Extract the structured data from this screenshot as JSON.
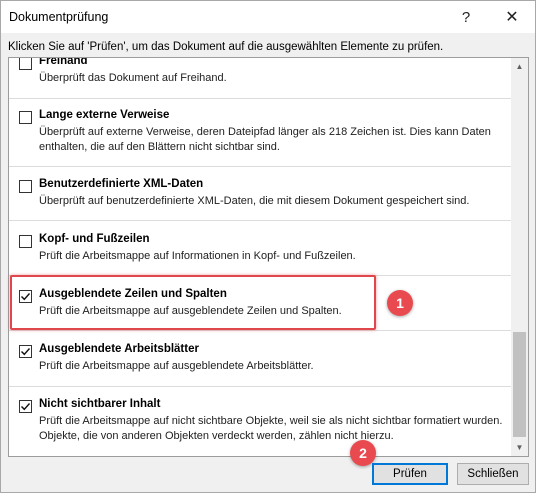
{
  "window": {
    "title": "Dokumentprüfung",
    "help_label": "?",
    "close_label": "✕"
  },
  "instruction": "Klicken Sie auf 'Prüfen', um das Dokument auf die ausgewählten Elemente zu prüfen.",
  "items": [
    {
      "title": "Freihand",
      "desc": "Überprüft das Dokument auf Freihand.",
      "checked": false
    },
    {
      "title": "Lange externe Verweise",
      "desc": "Überprüft auf externe Verweise, deren Dateipfad länger als 218 Zeichen ist. Dies kann Daten enthalten, die auf den Blättern nicht sichtbar sind.",
      "checked": false
    },
    {
      "title": "Benutzerdefinierte XML-Daten",
      "desc": "Überprüft auf benutzerdefinierte XML-Daten, die mit diesem Dokument gespeichert sind.",
      "checked": false
    },
    {
      "title": "Kopf- und Fußzeilen",
      "desc": "Prüft die Arbeitsmappe auf Informationen in Kopf- und Fußzeilen.",
      "checked": false
    },
    {
      "title": "Ausgeblendete Zeilen und Spalten",
      "desc": "Prüft die Arbeitsmappe auf ausgeblendete Zeilen und Spalten.",
      "checked": true
    },
    {
      "title": "Ausgeblendete Arbeitsblätter",
      "desc": "Prüft die Arbeitsmappe auf ausgeblendete Arbeitsblätter.",
      "checked": true
    },
    {
      "title": "Nicht sichtbarer Inhalt",
      "desc": "Prüft die Arbeitsmappe auf nicht sichtbare Objekte, weil sie als nicht sichtbar formatiert wurden. Objekte, die von anderen Objekten verdeckt werden, zählen nicht hierzu.",
      "checked": true
    }
  ],
  "annotations": {
    "badge_1": "1",
    "badge_2": "2"
  },
  "buttons": {
    "check": "Prüfen",
    "close": "Schließen"
  },
  "colors": {
    "highlight": "#e0474c",
    "badge": "#e84a4f",
    "focus": "#0078d7"
  }
}
